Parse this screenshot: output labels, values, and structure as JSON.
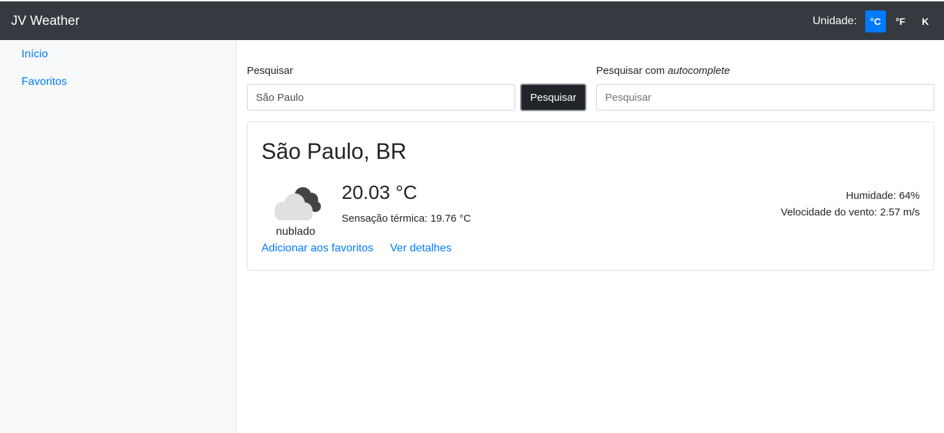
{
  "header": {
    "brand": "JV Weather",
    "unit_label": "Unidade:",
    "units": [
      {
        "label": "°C",
        "active": true
      },
      {
        "label": "°F",
        "active": false
      },
      {
        "label": "K",
        "active": false
      }
    ]
  },
  "sidebar": {
    "items": [
      {
        "label": "Início"
      },
      {
        "label": "Favoritos"
      }
    ]
  },
  "search": {
    "label": "Pesquisar",
    "value": "São Paulo",
    "button_label": "Pesquisar"
  },
  "autocomplete": {
    "label_prefix": "Pesquisar com ",
    "label_emphasis": "autocomplete",
    "placeholder": "Pesquisar"
  },
  "weather": {
    "city": "São Paulo, BR",
    "icon": "cloudy-icon",
    "condition": "nublado",
    "temperature": "20.03 °C",
    "feels_like": "Sensação térmica: 19.76 °C",
    "humidity": "Humidade: 64%",
    "wind": "Velocidade do vento: 2.57 m/s",
    "add_favorite": "Adicionar aos favoritos",
    "details": "Ver detalhes"
  },
  "colors": {
    "navbar": "#343a40",
    "accent": "#007bff",
    "button_dark": "#212529",
    "sidebar_bg": "#f8f9fa"
  }
}
